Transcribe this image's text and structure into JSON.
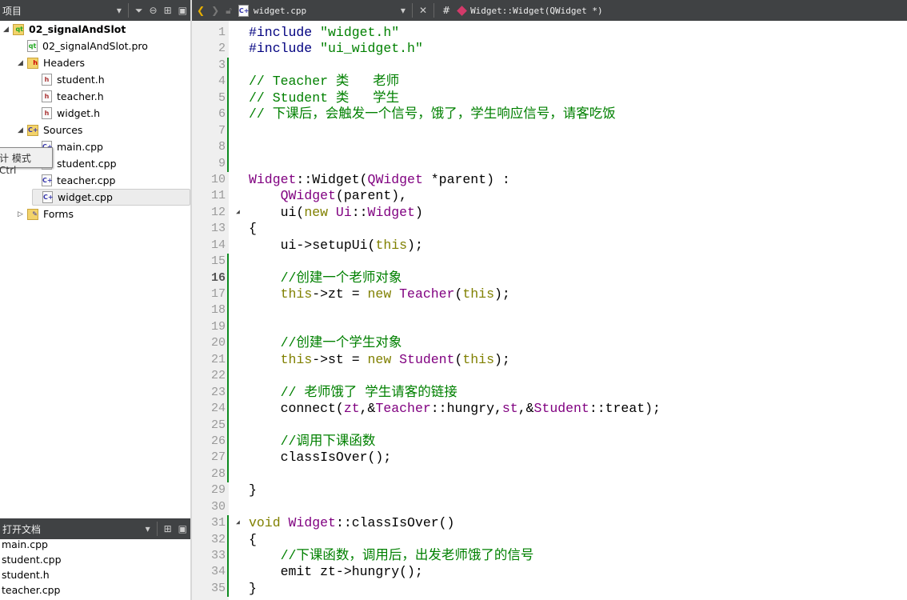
{
  "project_bar": {
    "title": "项目"
  },
  "editor_bar": {
    "file": "widget.cpp",
    "hash": "#",
    "symbol": "Widget::Widget(QWidget *)"
  },
  "tree": [
    {
      "label": "02_signalAndSlot",
      "level": 0,
      "kind": "project",
      "expanded": true,
      "bold": true
    },
    {
      "label": "02_signalAndSlot.pro",
      "level": 1,
      "kind": "pro"
    },
    {
      "label": "Headers",
      "level": 1,
      "kind": "folder-h",
      "expanded": true
    },
    {
      "label": "student.h",
      "level": 2,
      "kind": "h"
    },
    {
      "label": "teacher.h",
      "level": 2,
      "kind": "h"
    },
    {
      "label": "widget.h",
      "level": 2,
      "kind": "h"
    },
    {
      "label": "Sources",
      "level": 1,
      "kind": "folder-cpp",
      "expanded": true
    },
    {
      "label": "main.cpp",
      "level": 2,
      "kind": "cpp"
    },
    {
      "label": "student.cpp",
      "level": 2,
      "kind": "cpp"
    },
    {
      "label": "teacher.cpp",
      "level": 2,
      "kind": "cpp"
    },
    {
      "label": "widget.cpp",
      "level": 2,
      "kind": "cpp",
      "selected": true
    },
    {
      "label": "Forms",
      "level": 1,
      "kind": "folder-ui",
      "expanded": false
    }
  ],
  "tooltip": "计 模式 Ctrl",
  "open_docs": {
    "title": "打开文档",
    "items": [
      "main.cpp",
      "student.cpp",
      "student.h",
      "teacher.cpp"
    ]
  },
  "current_line": 16,
  "changed_lines": [
    3,
    4,
    5,
    6,
    7,
    8,
    9,
    15,
    16,
    17,
    18,
    19,
    20,
    21,
    22,
    23,
    24,
    25,
    26,
    27,
    28,
    31,
    32,
    33,
    34,
    35
  ],
  "fold_lines": [
    12,
    31
  ],
  "code": [
    [
      [
        "#include ",
        "pp"
      ],
      [
        "\"widget.h\"",
        "str"
      ]
    ],
    [
      [
        "#include ",
        "pp"
      ],
      [
        "\"ui_widget.h\"",
        "str"
      ]
    ],
    [],
    [
      [
        "// Teacher 类   老师",
        "cm"
      ]
    ],
    [
      [
        "// Student 类   学生",
        "cm"
      ]
    ],
    [
      [
        "// 下课后，会触发一个信号，饿了，学生响应信号，请客吃饭",
        "cm"
      ]
    ],
    [],
    [],
    [],
    [
      [
        "Widget",
        "ty"
      ],
      [
        "::Widget(",
        ""
      ],
      [
        "QWidget",
        "ty"
      ],
      [
        " *parent) :",
        ""
      ]
    ],
    [
      [
        "    ",
        ""
      ],
      [
        "QWidget",
        "ty"
      ],
      [
        "(parent),",
        ""
      ]
    ],
    [
      [
        "    ui(",
        ""
      ],
      [
        "new ",
        "kw"
      ],
      [
        "Ui",
        "ty"
      ],
      [
        "::",
        ""
      ],
      [
        "Widget",
        "ty"
      ],
      [
        ")",
        ""
      ]
    ],
    [
      [
        "{",
        ""
      ]
    ],
    [
      [
        "    ui->setupUi(",
        ""
      ],
      [
        "this",
        "kw"
      ],
      [
        ");",
        ""
      ]
    ],
    [],
    [
      [
        "    ",
        ""
      ],
      [
        "//创建一个老师对象",
        "cm"
      ]
    ],
    [
      [
        "    ",
        ""
      ],
      [
        "this",
        "kw"
      ],
      [
        "->zt = ",
        ""
      ],
      [
        "new ",
        "kw"
      ],
      [
        "Teacher",
        "ty"
      ],
      [
        "(",
        ""
      ],
      [
        "this",
        "kw"
      ],
      [
        ");",
        ""
      ]
    ],
    [],
    [],
    [
      [
        "    ",
        ""
      ],
      [
        "//创建一个学生对象",
        "cm"
      ]
    ],
    [
      [
        "    ",
        ""
      ],
      [
        "this",
        "kw"
      ],
      [
        "->st = ",
        ""
      ],
      [
        "new ",
        "kw"
      ],
      [
        "Student",
        "ty"
      ],
      [
        "(",
        ""
      ],
      [
        "this",
        "kw"
      ],
      [
        ");",
        ""
      ]
    ],
    [],
    [
      [
        "    ",
        ""
      ],
      [
        "// 老师饿了 学生请客的链接",
        "cm"
      ]
    ],
    [
      [
        "    connect(",
        ""
      ],
      [
        "zt",
        "ty"
      ],
      [
        ",&",
        ""
      ],
      [
        "Teacher",
        "ty"
      ],
      [
        "::hungry,",
        ""
      ],
      [
        "st",
        "ty"
      ],
      [
        ",&",
        ""
      ],
      [
        "Student",
        "ty"
      ],
      [
        "::treat);",
        ""
      ]
    ],
    [],
    [
      [
        "    ",
        ""
      ],
      [
        "//调用下课函数",
        "cm"
      ]
    ],
    [
      [
        "    classIsOver();",
        ""
      ]
    ],
    [],
    [
      [
        "}",
        ""
      ]
    ],
    [],
    [
      [
        "void ",
        "kw"
      ],
      [
        "Widget",
        "ty"
      ],
      [
        "::classIsOver()",
        ""
      ]
    ],
    [
      [
        "{",
        ""
      ]
    ],
    [
      [
        "    ",
        ""
      ],
      [
        "//下课函数，调用后，出发老师饿了的信号",
        "cm"
      ]
    ],
    [
      [
        "    emit zt->hungry();",
        ""
      ]
    ],
    [
      [
        "}",
        ""
      ]
    ]
  ]
}
